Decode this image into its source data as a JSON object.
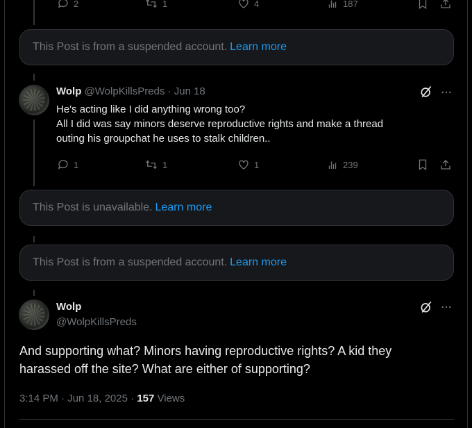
{
  "top_actions": {
    "replies": "2",
    "reposts": "1",
    "likes": "4",
    "views": "187"
  },
  "notice_1": {
    "text": "This Post is from a suspended account.",
    "link": "Learn more"
  },
  "reply_post": {
    "name": "Wolp",
    "handle": "@WolpKillsPreds",
    "sep": "·",
    "date": "Jun 18",
    "lines": [
      "He's acting like I did anything wrong too?",
      "All I did was say minors deserve reproductive rights and make a thread",
      "outing his groupchat he uses to stalk children.."
    ],
    "actions": {
      "replies": "1",
      "reposts": "1",
      "likes": "1",
      "views": "239"
    }
  },
  "notice_2": {
    "text": "This Post is unavailable.",
    "link": "Learn more"
  },
  "notice_3": {
    "text": "This Post is from a suspended account.",
    "link": "Learn more"
  },
  "main_post": {
    "name": "Wolp",
    "handle": "@WolpKillsPreds",
    "text_lines": [
      "And supporting what? Minors having reproductive rights? A kid they",
      "harassed off the site? What are either of supporting?"
    ],
    "time": "3:14 PM",
    "sep1": "·",
    "date": "Jun 18, 2025",
    "sep2": "·",
    "views_count": "157",
    "views_label": "Views"
  },
  "icons": [
    "reply-icon",
    "repost-icon",
    "like-icon",
    "views-icon",
    "bookmark-icon",
    "share-icon",
    "grok-icon",
    "more-icon"
  ],
  "colors": {
    "background": "#000000",
    "text": "#e7e9ea",
    "muted": "#71767b",
    "link": "#1d9bf0",
    "notice_bg": "#16181c",
    "border": "#2f3336"
  }
}
